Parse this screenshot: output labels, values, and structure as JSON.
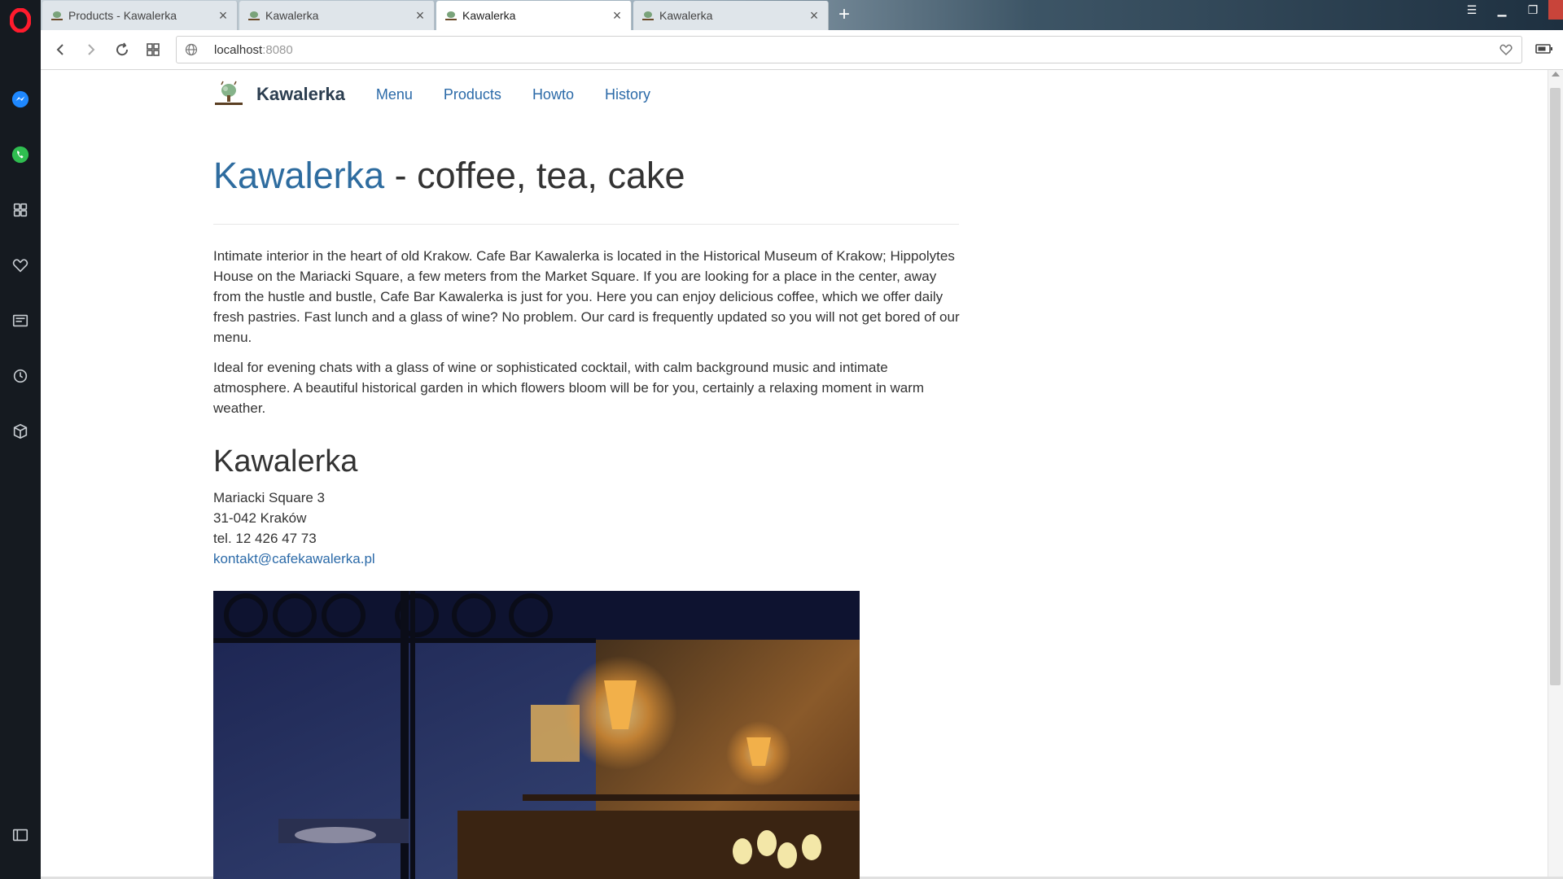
{
  "browser": {
    "tabs": [
      {
        "title": "Products - Kawalerka",
        "active": false
      },
      {
        "title": "Kawalerka",
        "active": false
      },
      {
        "title": "Kawalerka",
        "active": true
      },
      {
        "title": "Kawalerka",
        "active": false
      }
    ],
    "new_tab_symbol": "+",
    "url_host": "localhost",
    "url_port": ":8080"
  },
  "sidebar": {
    "items": [
      "opera-logo-icon",
      "messenger-icon",
      "whatsapp-icon",
      "speed-dial-icon",
      "bookmarks-icon",
      "news-icon",
      "history-icon",
      "extensions-icon",
      "sidebar-toggle-icon"
    ]
  },
  "site": {
    "brand": "Kawalerka",
    "nav": [
      "Menu",
      "Products",
      "Howto",
      "History"
    ]
  },
  "hero": {
    "title_highlight": "Kawalerka",
    "title_rest": " - coffee, tea, cake"
  },
  "content": {
    "paragraph1": "Intimate interior in the heart of old Krakow. Cafe Bar Kawalerka is located in the Historical Museum of Krakow; Hippolytes House on the Mariacki Square, a few meters from the Market Square. If you are looking for a place in the center, away from the hustle and bustle, Cafe Bar Kawalerka is just for you. Here you can enjoy delicious coffee, which we offer daily fresh pastries. Fast lunch and a glass of wine? No problem. Our card is frequently updated so you will not get bored of our menu.",
    "paragraph2": "Ideal for evening chats with a glass of wine or sophisticated cocktail, with calm background music and intimate atmosphere. A beautiful historical garden in which flowers bloom will be for you, certainly a relaxing moment in warm weather."
  },
  "contact": {
    "heading": "Kawalerka",
    "street": "Mariacki Square 3",
    "city": "31-042 Kraków",
    "phone": "tel. 12 426 47 73",
    "email": "kontakt@cafekawalerka.pl"
  },
  "colors": {
    "link": "#2b6aa8",
    "brand": "#2c3e50",
    "sidebar": "#151a20"
  }
}
